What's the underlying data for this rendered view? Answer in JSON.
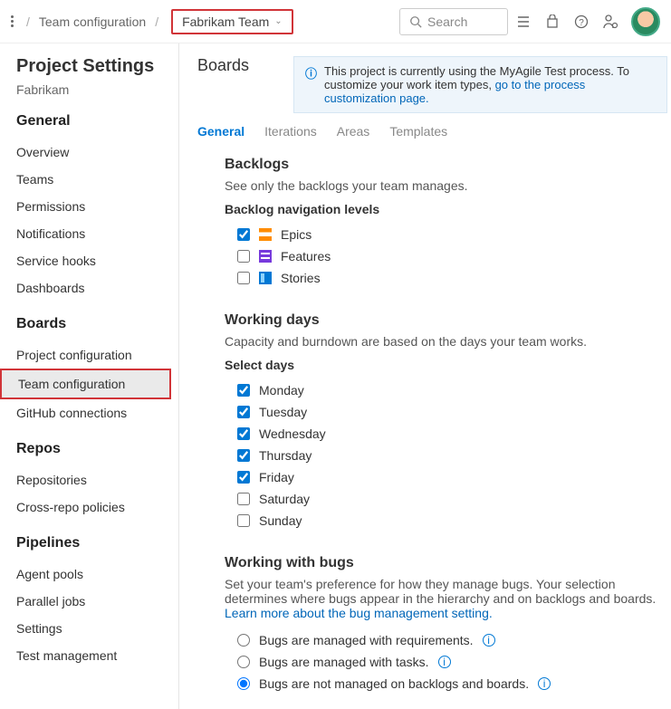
{
  "breadcrumb": {
    "item1": "Team configuration",
    "team": "Fabrikam Team"
  },
  "search": {
    "placeholder": "Search"
  },
  "sidebar": {
    "title": "Project Settings",
    "project": "Fabrikam",
    "sections": {
      "general": {
        "title": "General",
        "items": [
          "Overview",
          "Teams",
          "Permissions",
          "Notifications",
          "Service hooks",
          "Dashboards"
        ]
      },
      "boards": {
        "title": "Boards",
        "items": [
          "Project configuration",
          "Team configuration",
          "GitHub connections"
        ]
      },
      "repos": {
        "title": "Repos",
        "items": [
          "Repositories",
          "Cross-repo policies"
        ]
      },
      "pipelines": {
        "title": "Pipelines",
        "items": [
          "Agent pools",
          "Parallel jobs",
          "Settings",
          "Test management"
        ]
      }
    }
  },
  "page": {
    "title": "Boards",
    "banner": {
      "text": "This project is currently using the MyAgile Test process. To customize your work item types, ",
      "link_text": "go to the process customization page."
    },
    "tabs": [
      "General",
      "Iterations",
      "Areas",
      "Templates"
    ],
    "backlogs": {
      "heading": "Backlogs",
      "desc": "See only the backlogs your team manages.",
      "sub": "Backlog navigation levels",
      "levels": [
        {
          "label": "Epics",
          "checked": true
        },
        {
          "label": "Features",
          "checked": false
        },
        {
          "label": "Stories",
          "checked": false
        }
      ]
    },
    "workingdays": {
      "heading": "Working days",
      "desc": "Capacity and burndown are based on the days your team works.",
      "sub": "Select days",
      "days": [
        {
          "label": "Monday",
          "checked": true
        },
        {
          "label": "Tuesday",
          "checked": true
        },
        {
          "label": "Wednesday",
          "checked": true
        },
        {
          "label": "Thursday",
          "checked": true
        },
        {
          "label": "Friday",
          "checked": true
        },
        {
          "label": "Saturday",
          "checked": false
        },
        {
          "label": "Sunday",
          "checked": false
        }
      ]
    },
    "bugs": {
      "heading": "Working with bugs",
      "desc": "Set your team's preference for how they manage bugs. Your selection determines where bugs appear in the hierarchy and on backlogs and boards. ",
      "link_text": "Learn more about the bug management setting.",
      "options": [
        {
          "label": "Bugs are managed with requirements.",
          "selected": false
        },
        {
          "label": "Bugs are managed with tasks.",
          "selected": false
        },
        {
          "label": "Bugs are not managed on backlogs and boards.",
          "selected": true
        }
      ]
    }
  }
}
